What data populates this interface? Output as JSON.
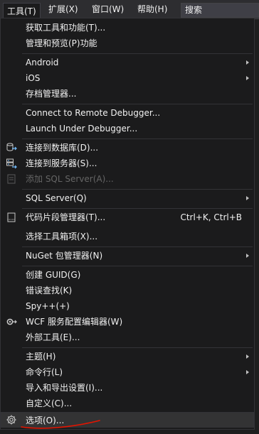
{
  "menubar": {
    "tools": "工具(T)",
    "extensions": "扩展(X)",
    "window": "窗口(W)",
    "help": "帮助(H)",
    "search": "搜索"
  },
  "menu": {
    "get_tools": "获取工具和功能(T)...",
    "manage_preview": "管理和预览(P)功能",
    "android": "Android",
    "ios": "iOS",
    "archive_manager": "存档管理器...",
    "connect_remote_debugger": "Connect to Remote Debugger...",
    "launch_under_debugger": "Launch Under Debugger...",
    "connect_database": "连接到数据库(D)...",
    "connect_server": "连接到服务器(S)...",
    "add_sql_server": "添加 SQL Server(A)...",
    "sql_server": "SQL Server(Q)",
    "code_snippets_manager": "代码片段管理器(T)...",
    "code_snippets_shortcut": "Ctrl+K, Ctrl+B",
    "choose_toolbox_items": "选择工具箱项(X)...",
    "nuget_manager": "NuGet 包管理器(N)",
    "create_guid": "创建 GUID(G)",
    "error_lookup": "错误查找(K)",
    "spy": "Spy++(+)",
    "wcf_editor": "WCF 服务配置编辑器(W)",
    "external_tools": "外部工具(E)...",
    "theme": "主题(H)",
    "command_line": "命令行(L)",
    "import_export": "导入和导出设置(I)...",
    "customize": "自定义(C)...",
    "options": "选项(O)..."
  },
  "colors": {
    "menu_bg": "#1b1b1c",
    "menubar_bg": "#2d2d30",
    "highlight": "#333334",
    "icon_accent": "#75beff",
    "annotation_red": "#e51400"
  }
}
